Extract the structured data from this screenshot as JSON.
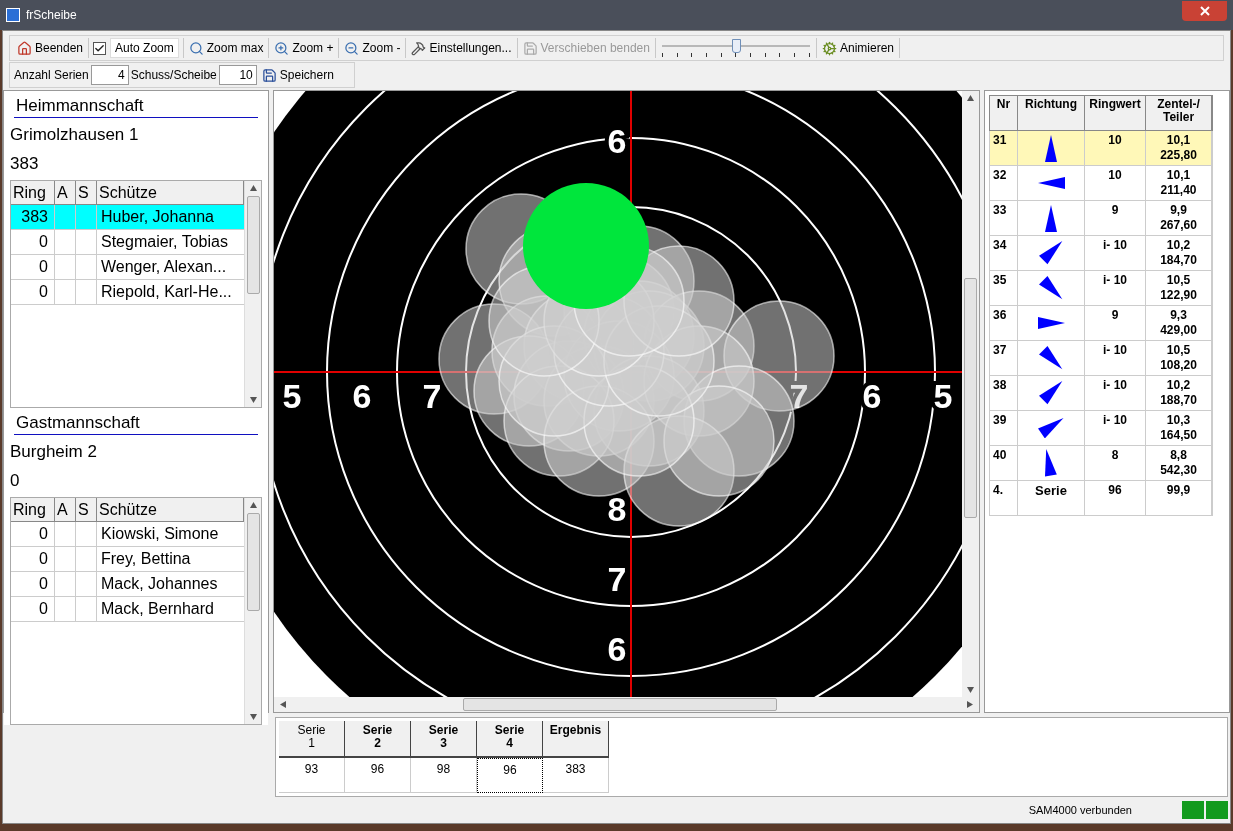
{
  "window": {
    "title": "frScheibe"
  },
  "toolbar": [
    {
      "kind": "button",
      "label": "Beenden",
      "disabled": false
    },
    {
      "kind": "checkbox",
      "label": "Auto Zoom",
      "checked": true
    },
    {
      "kind": "button",
      "label": "Zoom max",
      "disabled": false
    },
    {
      "kind": "button",
      "label": "Zoom +",
      "disabled": false
    },
    {
      "kind": "button",
      "label": "Zoom -",
      "disabled": false
    },
    {
      "kind": "button",
      "label": "Einstellungen...",
      "disabled": false
    },
    {
      "kind": "button",
      "label": "Verschieben benden",
      "disabled": true
    },
    {
      "kind": "slider",
      "level": 0.5
    },
    {
      "kind": "button",
      "label": "Animieren",
      "disabled": false
    }
  ],
  "toolbar_row2": [
    {
      "kind": "label",
      "text": "Anzahl Serien"
    },
    {
      "kind": "field",
      "value": "4"
    },
    {
      "kind": "label",
      "text": "Schuss/Scheibe"
    },
    {
      "kind": "field",
      "value": "10"
    },
    {
      "kind": "button",
      "text": "Speichern"
    }
  ],
  "teams": [
    {
      "heading": "Heimmannschaft",
      "name": "Grimolzhausen 1",
      "total": "383",
      "columns": [
        "Ring",
        "A",
        "S",
        "Schütze"
      ],
      "rows": [
        {
          "ring": "383",
          "shooter": "Huber, Johanna",
          "selected": true
        },
        {
          "ring": "0",
          "shooter": "Stegmaier, Tobias",
          "selected": false
        },
        {
          "ring": "0",
          "shooter": "Wenger, Alexan...",
          "selected": false
        },
        {
          "ring": "0",
          "shooter": "Riepold, Karl-He...",
          "selected": false
        }
      ]
    },
    {
      "heading": "Gastmannschaft",
      "name": "Burgheim 2",
      "total": "0",
      "columns": [
        "Ring",
        "A",
        "S",
        "Schütze"
      ],
      "rows": [
        {
          "ring": "0",
          "shooter": "Kiowski, Simone",
          "selected": false
        },
        {
          "ring": "0",
          "shooter": "Frey, Bettina",
          "selected": false
        },
        {
          "ring": "0",
          "shooter": "Mack, Johannes",
          "selected": false
        },
        {
          "ring": "0",
          "shooter": "Mack, Bernhard",
          "selected": false
        }
      ]
    }
  ],
  "target": {
    "labels": [
      "6",
      "5",
      "6",
      "7",
      "7",
      "6",
      "5",
      "8",
      "7",
      "6"
    ]
  },
  "shots_table": {
    "columns": [
      "Nr",
      "Richtung",
      "Ringwert",
      "Zentel-/\nTeiler"
    ],
    "rows": [
      {
        "kind": "shot",
        "nr": "31",
        "ring": "10",
        "tenth": "10,1",
        "teiler": "225,80",
        "selected": true
      },
      {
        "kind": "shot",
        "nr": "32",
        "ring": "10",
        "tenth": "10,1",
        "teiler": "211,40",
        "selected": false
      },
      {
        "kind": "shot",
        "nr": "33",
        "ring": "9",
        "tenth": "9,9",
        "teiler": "267,60",
        "selected": false
      },
      {
        "kind": "shot",
        "nr": "34",
        "ring": "i- 10",
        "tenth": "10,2",
        "teiler": "184,70",
        "selected": false
      },
      {
        "kind": "shot",
        "nr": "35",
        "ring": "i- 10",
        "tenth": "10,5",
        "teiler": "122,90",
        "selected": false
      },
      {
        "kind": "shot",
        "nr": "36",
        "ring": "9",
        "tenth": "9,3",
        "teiler": "429,00",
        "selected": false
      },
      {
        "kind": "shot",
        "nr": "37",
        "ring": "i- 10",
        "tenth": "10,5",
        "teiler": "108,20",
        "selected": false
      },
      {
        "kind": "shot",
        "nr": "38",
        "ring": "i- 10",
        "tenth": "10,2",
        "teiler": "188,70",
        "selected": false
      },
      {
        "kind": "shot",
        "nr": "39",
        "ring": "i- 10",
        "tenth": "10,3",
        "teiler": "164,50",
        "selected": false
      },
      {
        "kind": "shot",
        "nr": "40",
        "ring": "8",
        "tenth": "8,8",
        "teiler": "542,30",
        "selected": false
      },
      {
        "kind": "total",
        "nr": "4.",
        "label": "Serie",
        "ring": "96",
        "tenth": "99,9",
        "selected": false
      }
    ]
  },
  "series_table": {
    "columns": [
      {
        "label": "Serie\n1",
        "bold": false
      },
      {
        "label": "Serie\n2",
        "bold": true
      },
      {
        "label": "Serie\n3",
        "bold": true
      },
      {
        "label": "Serie\n4",
        "bold": true
      },
      {
        "label": "Ergebnis",
        "bold": true
      }
    ],
    "values": [
      {
        "text": "93",
        "focused": false
      },
      {
        "text": "96",
        "focused": false
      },
      {
        "text": "98",
        "focused": false
      },
      {
        "text": "96",
        "focused": true
      },
      {
        "text": "383",
        "focused": false
      }
    ]
  },
  "status_bar": {
    "text": "SAM4000 verbunden"
  }
}
